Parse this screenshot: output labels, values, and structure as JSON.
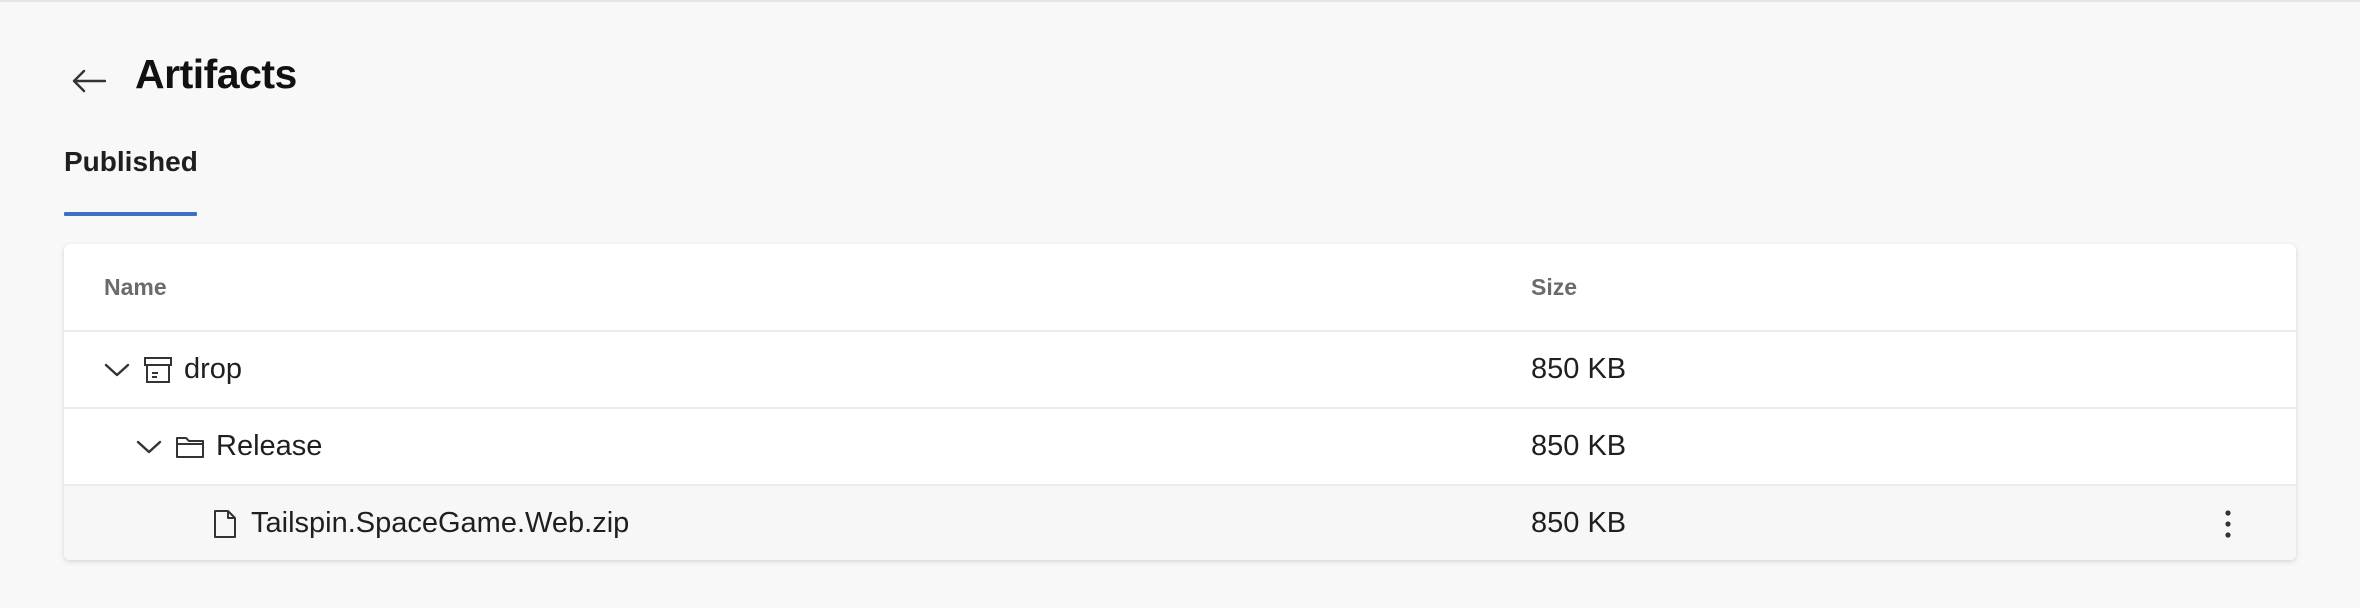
{
  "page": {
    "title": "Artifacts"
  },
  "tabs": [
    {
      "label": "Published",
      "selected": true
    }
  ],
  "table": {
    "columns": {
      "name": "Name",
      "size": "Size"
    },
    "rows": [
      {
        "name": "drop",
        "size": "850 KB",
        "type": "artifact",
        "icon": "archive-icon",
        "expanded": true,
        "depth": 0
      },
      {
        "name": "Release",
        "size": "850 KB",
        "type": "folder",
        "icon": "folder-icon",
        "expanded": true,
        "depth": 1
      },
      {
        "name": "Tailspin.SpaceGame.Web.zip",
        "size": "850 KB",
        "type": "file",
        "icon": "file-icon",
        "depth": 2
      }
    ]
  },
  "colors": {
    "accent": "#3f6fc4",
    "background": "#f8f8f8",
    "card": "#ffffff"
  }
}
